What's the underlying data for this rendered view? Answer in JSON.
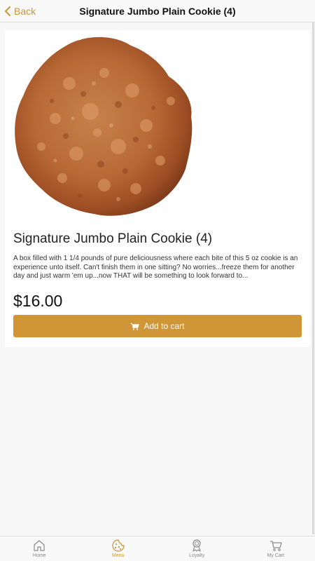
{
  "header": {
    "back_label": "Back",
    "title": "Signature Jumbo Plain Cookie (4)"
  },
  "product": {
    "name": "Signature Jumbo Plain Cookie (4)",
    "description": "A box filled with 1 1/4 pounds of pure deliciousness where each bite of this 5 oz cookie is an experience unto itself. Can't finish them in one sitting? No worries...freeze them for another day and just warm 'em up...now THAT will be something to look forward to...",
    "price": "$16.00",
    "add_to_cart_label": "Add to cart",
    "image_icon": "cookie-photo"
  },
  "tabs": [
    {
      "label": "Home",
      "icon": "home-icon"
    },
    {
      "label": "Menu",
      "icon": "cookie-icon",
      "active": true
    },
    {
      "label": "Loyalty",
      "icon": "award-icon"
    },
    {
      "label": "My Cart",
      "icon": "cart-icon"
    }
  ],
  "colors": {
    "accent": "#cf9537",
    "background": "#f7f7f7",
    "card": "#ffffff"
  }
}
